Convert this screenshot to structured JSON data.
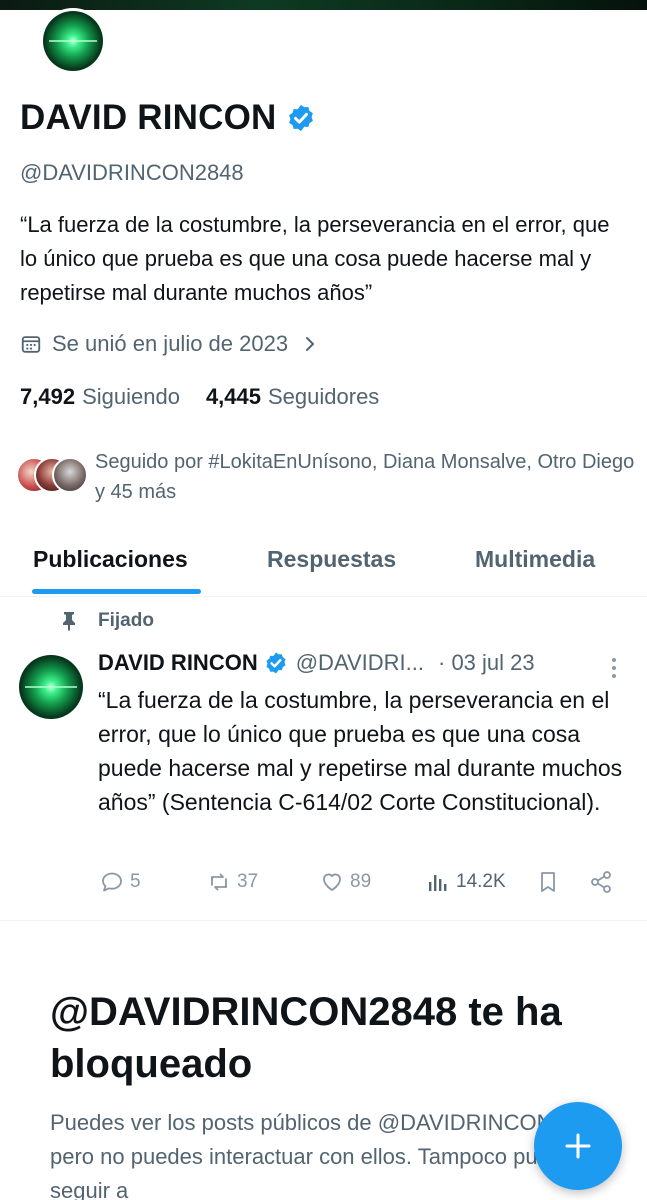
{
  "profile": {
    "display_name": "DAVID RINCON",
    "handle": "@DAVIDRINCON2848",
    "bio": "“La fuerza de la costumbre, la perseverancia en el error, que lo único que prueba es que una cosa puede hacerse mal y repetirse mal durante muchos años”",
    "joined": "Se unió en julio de 2023",
    "following_count": "7,492",
    "following_label": "Siguiendo",
    "followers_count": "4,445",
    "followers_label": "Seguidores",
    "followed_by": "Seguido por #LokitaEnUnísono, Diana Monsalve, Otro Diego y 45 más",
    "verified": true
  },
  "tabs": [
    {
      "label": "Publicaciones",
      "active": true
    },
    {
      "label": "Respuestas",
      "active": false
    },
    {
      "label": "Multimedia",
      "active": false
    }
  ],
  "pinned_post": {
    "pinned_label": "Fijado",
    "author_name": "DAVID RINCON",
    "author_handle": "@DAVIDRI...",
    "date": "· 03 jul 23",
    "text": "“La fuerza de la costumbre, la perseverancia en el error, que lo único que prueba es que una cosa puede hacerse mal y repetirse mal durante muchos años” (Sentencia C-614/02 Corte Constitucional).",
    "replies": "5",
    "reposts": "37",
    "likes": "89",
    "views": "14.2K"
  },
  "blocked": {
    "title": "@DAVIDRINCON2848 te ha bloqueado",
    "text": "Puedes ver los posts públicos de @DAVIDRINCON2848, pero no puedes interactuar con ellos. Tampoco puedes seguir a"
  },
  "colors": {
    "accent": "#1d9bf0",
    "text_primary": "#0f1419",
    "text_secondary": "#536471"
  },
  "icons": {
    "verified": "verified-badge-icon",
    "calendar": "calendar-icon",
    "chevron": "chevron-right-icon",
    "pin": "pin-icon",
    "more": "more-vertical-icon",
    "reply": "reply-icon",
    "repost": "repost-icon",
    "like": "heart-icon",
    "views": "views-bar-icon",
    "bookmark": "bookmark-icon",
    "share": "share-icon",
    "compose": "plus-icon"
  }
}
